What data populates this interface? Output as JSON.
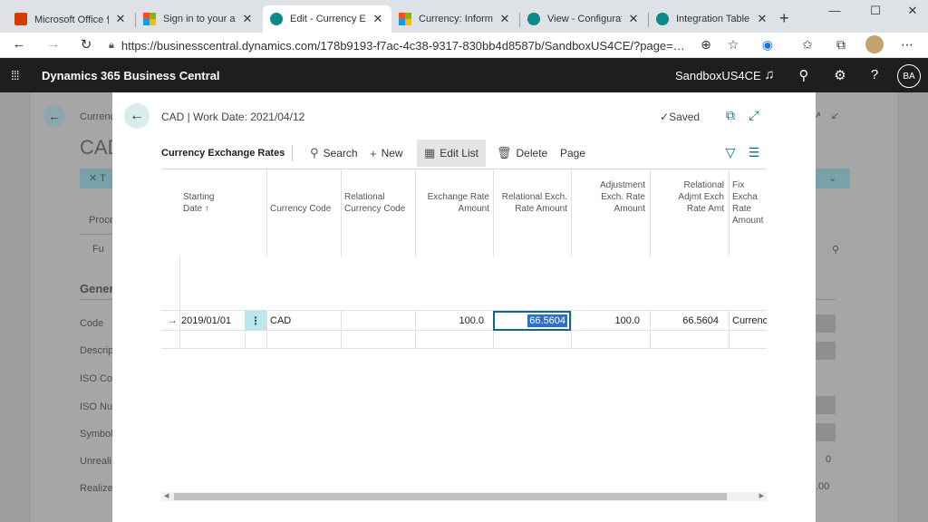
{
  "browser": {
    "tabs": [
      {
        "title": "Microsoft Office 件-…",
        "icon": "office-icon"
      },
      {
        "title": "Sign in to your acco…",
        "icon": "microsoft-icon"
      },
      {
        "title": "Edit - Currency Exch…",
        "icon": "business-central-icon"
      },
      {
        "title": "Currency: Informatio…",
        "icon": "microsoft-icon"
      },
      {
        "title": "View - Configuration…",
        "icon": "business-central-icon"
      },
      {
        "title": "Integration Table Ma…",
        "icon": "business-central-icon"
      }
    ],
    "url": "https://businesscentral.dynamics.com/178b9193-f7ac-4c38-9317-830bb4d8587b/SandboxUS4CE/?page=…"
  },
  "app": {
    "name": "Dynamics 365 Business Central",
    "environment": "SandboxUS4CE",
    "user_initials": "BA"
  },
  "background_page": {
    "breadcrumb": "Currenc",
    "title": "CAD",
    "process_tab": "Proce",
    "function_item": "Fu",
    "section": "Gener",
    "fields": [
      "Code",
      "Descrip",
      "ISO Coo",
      "ISO Nu",
      "Symbol",
      "Unreali",
      "Realize"
    ],
    "value_0": "0",
    "value_00": ".00"
  },
  "dialog": {
    "title": "CAD | Work Date: 2021/04/12",
    "saved_label": "Saved",
    "page_name": "Currency Exchange Rates",
    "actions": {
      "search": "Search",
      "new": "New",
      "edit_list": "Edit List",
      "delete": "Delete",
      "page": "Page"
    },
    "columns": [
      {
        "line1": "Starting",
        "line2": "Date ↑",
        "line3": ""
      },
      {
        "line1": "",
        "line2": "",
        "line3": "Currency Code"
      },
      {
        "line1": "",
        "line2": "Relational",
        "line3": "Currency Code"
      },
      {
        "line1": "",
        "line2": "Exchange Rate",
        "line3": "Amount"
      },
      {
        "line1": "",
        "line2": "Relational Exch.",
        "line3": "Rate Amount"
      },
      {
        "line1": "Adjustment",
        "line2": "Exch. Rate",
        "line3": "Amount"
      },
      {
        "line1": "Relational",
        "line2": "Adjmt Exch",
        "line3": "Rate Amt"
      },
      {
        "line1": "Fix Excha",
        "line2": "Rate",
        "line3": "Amount"
      }
    ],
    "row": {
      "starting_date": "2019/01/01",
      "currency_code": "CAD",
      "relational_currency_code": "",
      "exchange_rate_amount": "100.0",
      "relational_exch_rate_amount": "66.5604",
      "adjustment_exch_rate_amount": "100.0",
      "relational_adjmt_exch_rate_amt": "66.5604",
      "fix_exchange_rate_amount": "Currenc"
    }
  }
}
